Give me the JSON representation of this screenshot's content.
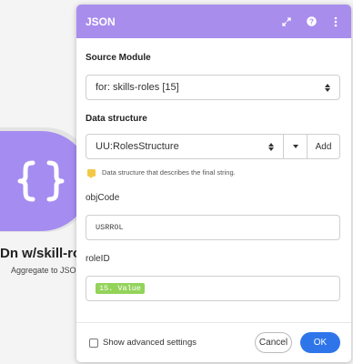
{
  "canvas": {
    "module_title": "Dn w/skill-ro",
    "module_subtitle": "Aggregate to JSON",
    "module_icon": "curly-braces-icon",
    "module_color": "#a58cf0"
  },
  "dialog": {
    "title": "JSON",
    "header_color": "#a88ded",
    "header_icons": [
      "expand-icon",
      "help-icon",
      "more-icon"
    ]
  },
  "source_module": {
    "label": "Source Module",
    "value": "for: skills-roles [15]"
  },
  "data_structure": {
    "label": "Data structure",
    "value": "UU:RolesStructure",
    "add_label": "Add",
    "hint": "Data structure that describes the final string."
  },
  "fields": {
    "objCode": {
      "label": "objCode",
      "value": "USRROL"
    },
    "roleID": {
      "label": "roleID",
      "value": "15. Value",
      "pill_color": "#93d35a"
    }
  },
  "footer": {
    "advanced_label": "Show advanced settings",
    "advanced_checked": false,
    "cancel_label": "Cancel",
    "ok_label": "OK",
    "ok_color": "#2f75ea"
  }
}
